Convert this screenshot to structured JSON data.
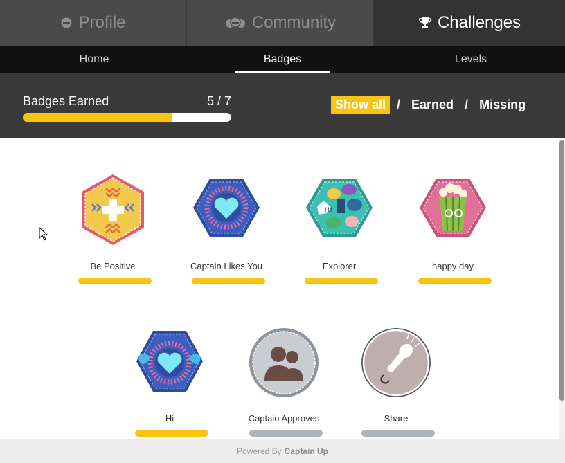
{
  "top_tabs": [
    {
      "label": "Profile",
      "icon": "profile-icon"
    },
    {
      "label": "Community",
      "icon": "community-icon"
    },
    {
      "label": "Challenges",
      "icon": "trophy-icon",
      "active": true
    }
  ],
  "sub_nav": {
    "items": [
      "Home",
      "Badges",
      "Levels"
    ],
    "active": "Badges"
  },
  "summary": {
    "label": "Badges Earned",
    "count_text": "5 / 7",
    "earned": 5,
    "total": 7,
    "progress_fraction": 0.714
  },
  "filters": {
    "items": [
      "Show all",
      "Earned",
      "Missing"
    ],
    "separator": "/",
    "active": "Show all"
  },
  "badges": [
    {
      "name": "Be Positive",
      "icon": "be-positive-badge-icon",
      "earned": true
    },
    {
      "name": "Captain Likes You",
      "icon": "heart-badge-icon",
      "earned": true
    },
    {
      "name": "Explorer",
      "icon": "speech-bubbles-badge-icon",
      "earned": true
    },
    {
      "name": "happy day",
      "icon": "popcorn-badge-icon",
      "earned": true
    },
    {
      "name": "Hi",
      "icon": "winged-heart-badge-icon",
      "earned": true
    },
    {
      "name": "Captain Approves",
      "icon": "people-badge-icon",
      "earned": false
    },
    {
      "name": "Share",
      "icon": "microphone-badge-icon",
      "earned": false
    }
  ],
  "footer": {
    "prefix": "Powered By",
    "brand": "Captain Up"
  },
  "colors": {
    "accent": "#f9c312",
    "missing_bar": "#aeb3b9",
    "header_bg": "#3a3a3a",
    "subnav_bg": "#111111"
  }
}
